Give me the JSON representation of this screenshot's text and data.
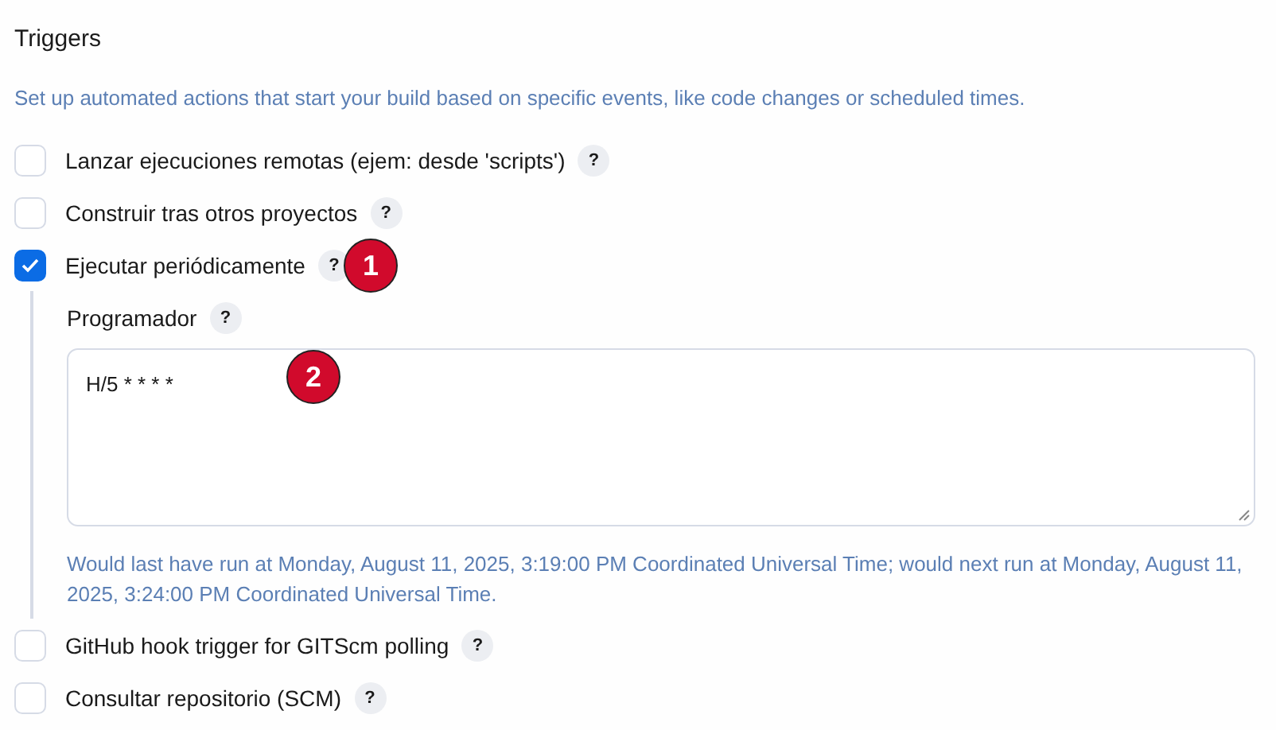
{
  "section": {
    "title": "Triggers",
    "description": "Set up automated actions that start your build based on specific events, like code changes or scheduled times."
  },
  "triggers": [
    {
      "label": "Lanzar ejecuciones remotas (ejem: desde 'scripts')",
      "help": "?",
      "checked": false
    },
    {
      "label": "Construir tras otros proyectos",
      "help": "?",
      "checked": false
    },
    {
      "label": "Ejecutar periódicamente",
      "help": "?",
      "checked": true,
      "schedule": {
        "label": "Programador",
        "help": "?",
        "value": "H/5 * * * *",
        "note": "Would last have run at Monday, August 11, 2025, 3:19:00 PM Coordinated Universal Time; would next run at Monday, August 11, 2025, 3:24:00 PM Coordinated Universal Time."
      }
    },
    {
      "label": "GitHub hook trigger for GITScm polling",
      "help": "?",
      "checked": false
    },
    {
      "label": "Consultar repositorio (SCM)",
      "help": "?",
      "checked": false
    }
  ],
  "annotations": [
    {
      "number": "1"
    },
    {
      "number": "2"
    }
  ]
}
